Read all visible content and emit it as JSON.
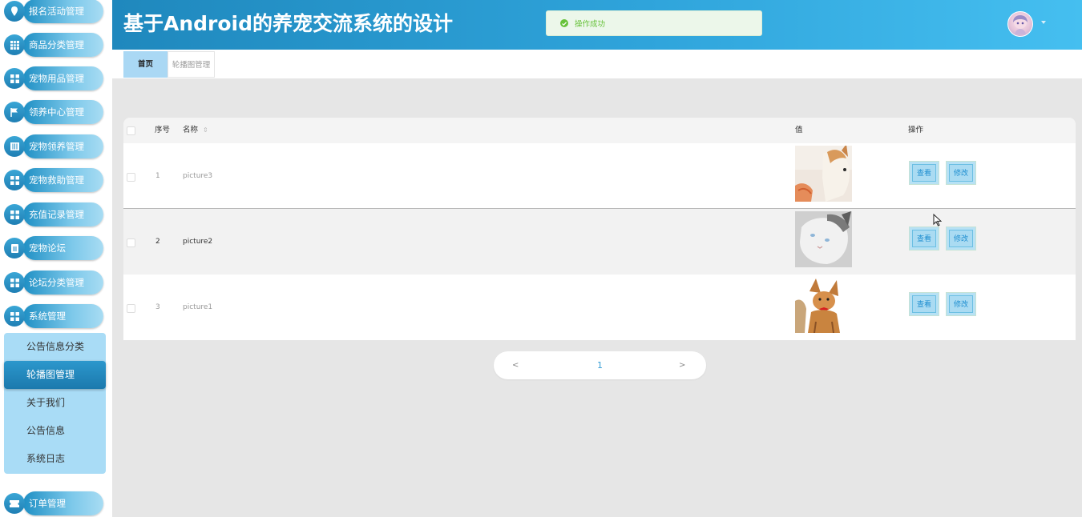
{
  "sidebar": {
    "items": [
      {
        "label": "报名活动管理",
        "icon": "location-pin-icon"
      },
      {
        "label": "商品分类管理",
        "icon": "grid-icon"
      },
      {
        "label": "宠物用品管理",
        "icon": "apps-icon"
      },
      {
        "label": "领养中心管理",
        "icon": "flag-icon"
      },
      {
        "label": "宠物领养管理",
        "icon": "book-icon"
      },
      {
        "label": "宠物救助管理",
        "icon": "apps-icon"
      },
      {
        "label": "充值记录管理",
        "icon": "apps-icon"
      },
      {
        "label": "宠物论坛",
        "icon": "document-icon"
      },
      {
        "label": "论坛分类管理",
        "icon": "apps-icon"
      },
      {
        "label": "系统管理",
        "icon": "apps-icon"
      },
      {
        "label": "订单管理",
        "icon": "ticket-icon"
      }
    ],
    "submenu": [
      {
        "label": "公告信息分类",
        "active": false
      },
      {
        "label": "轮播图管理",
        "active": true
      },
      {
        "label": "关于我们",
        "active": false
      },
      {
        "label": "公告信息",
        "active": false
      },
      {
        "label": "系统日志",
        "active": false
      }
    ]
  },
  "header": {
    "title": "基于Android的养宠交流系统的设计",
    "toast": "操作成功"
  },
  "tabs": [
    "首页",
    "轮播图管理"
  ],
  "table": {
    "columns": [
      "序号",
      "名称",
      "值",
      "操作"
    ],
    "rows": [
      {
        "index": "1",
        "name": "picture3",
        "image": "corgi-photo"
      },
      {
        "index": "2",
        "name": "picture2",
        "image": "cat-photo"
      },
      {
        "index": "3",
        "name": "picture1",
        "image": "chihuahua-photo"
      }
    ],
    "view_label": "查看",
    "edit_label": "修改"
  },
  "pagination": {
    "prev": "<",
    "current": "1",
    "next": ">"
  },
  "colors": {
    "header_start": "#1f88bd",
    "header_end": "#45bff0",
    "submenu_bg": "#a9dcf6",
    "success": "#67c23a",
    "button_text": "#1e8ed0"
  }
}
